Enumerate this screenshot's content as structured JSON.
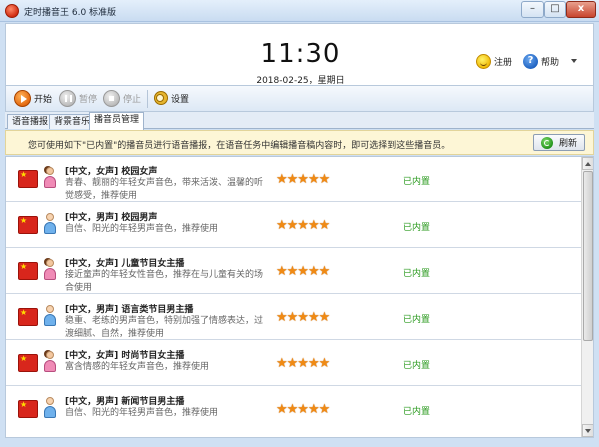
{
  "window": {
    "title": "定时播音王 6.0 标准版",
    "minimize_label": "–",
    "maximize_label": "□",
    "close_label": "x"
  },
  "header": {
    "time": "11:30",
    "date": "2018-02-25，星期日",
    "register_label": "注册",
    "help_label": "帮助"
  },
  "toolbar": {
    "start_label": "开始",
    "pause_label": "暂停",
    "stop_label": "停止",
    "settings_label": "设置"
  },
  "tabs": [
    {
      "label": "语音播报",
      "active": false
    },
    {
      "label": "背景音乐",
      "active": false
    },
    {
      "label": "播音员管理",
      "active": true
    }
  ],
  "info": {
    "message": "您可使用如下\"已内置\"的播音员进行语音播报，在语音任务中编辑播音稿内容时，即可选择到这些播音员。",
    "refresh_label": "刷新"
  },
  "voices": [
    {
      "name": "[中文，女声] 校园女声",
      "desc": "青春、靓丽的年轻女声音色，带来活泼、温馨的听觉感受，推荐使用",
      "gender": "female",
      "rating": 5,
      "stars": "★★★★★",
      "status": "已内置"
    },
    {
      "name": "[中文，男声] 校园男声",
      "desc": "自信、阳光的年轻男声音色，推荐使用",
      "gender": "male",
      "rating": 5,
      "stars": "★★★★★",
      "status": "已内置"
    },
    {
      "name": "[中文，女声] 儿童节目女主播",
      "desc": "接近童声的年轻女性音色，推荐在与儿童有关的场合使用",
      "gender": "female",
      "rating": 5,
      "stars": "★★★★★",
      "status": "已内置"
    },
    {
      "name": "[中文，男声] 语言类节目男主播",
      "desc": "稳重、老练的男声音色，特别加强了情感表达，过渡细腻、自然，推荐使用",
      "gender": "male",
      "rating": 5,
      "stars": "★★★★★",
      "status": "已内置"
    },
    {
      "name": "[中文，女声] 时尚节目女主播",
      "desc": "富含情感的年轻女声音色，推荐使用",
      "gender": "female",
      "rating": 5,
      "stars": "★★★★★",
      "status": "已内置"
    },
    {
      "name": "[中文，男声] 新闻节目男主播",
      "desc": "自信、阳光的年轻男声音色，推荐使用",
      "gender": "male",
      "rating": 5,
      "stars": "★★★★★",
      "status": "已内置"
    }
  ]
}
